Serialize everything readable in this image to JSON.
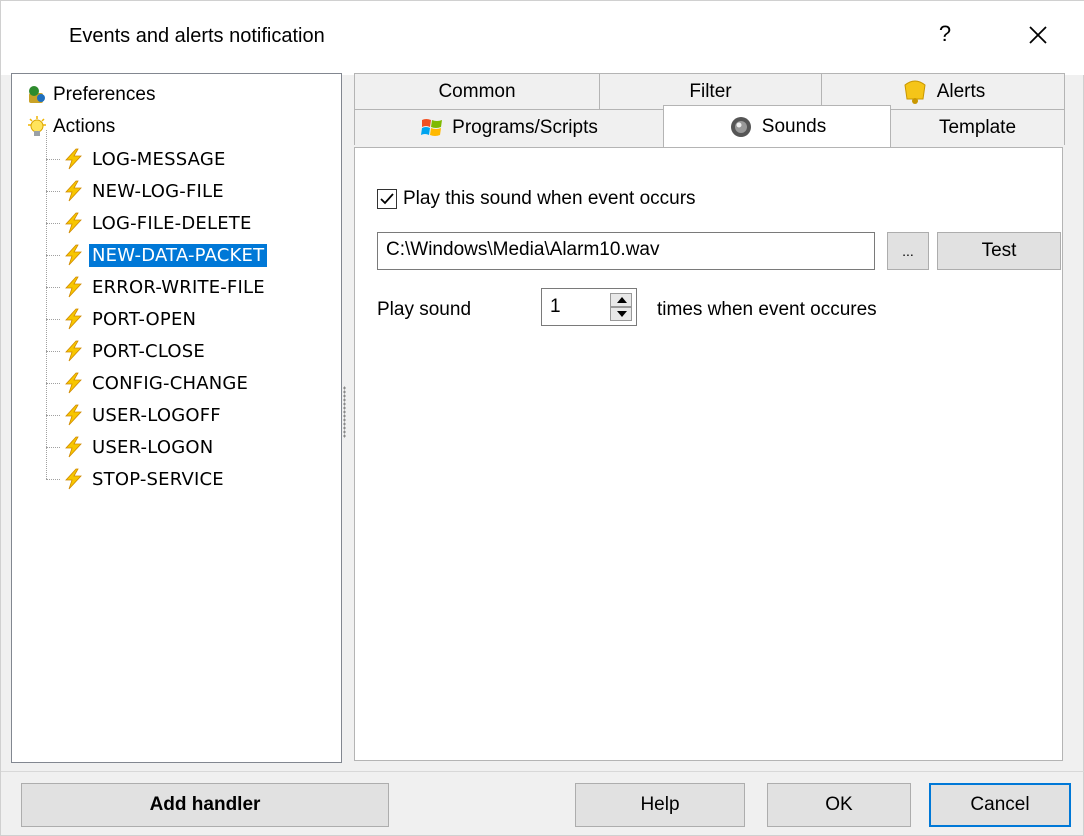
{
  "window": {
    "title": "Events and alerts notification",
    "help_glyph": "?",
    "close_glyph": "✕"
  },
  "tree": {
    "root_items": [
      {
        "label": "Preferences",
        "icon": "preferences-icon"
      },
      {
        "label": "Actions",
        "icon": "lightbulb-icon"
      }
    ],
    "action_items": [
      {
        "label": "LOG-MESSAGE",
        "selected": false
      },
      {
        "label": "NEW-LOG-FILE",
        "selected": false
      },
      {
        "label": "LOG-FILE-DELETE",
        "selected": false
      },
      {
        "label": "NEW-DATA-PACKET",
        "selected": true
      },
      {
        "label": "ERROR-WRITE-FILE",
        "selected": false
      },
      {
        "label": "PORT-OPEN",
        "selected": false
      },
      {
        "label": "PORT-CLOSE",
        "selected": false
      },
      {
        "label": "CONFIG-CHANGE",
        "selected": false
      },
      {
        "label": "USER-LOGOFF",
        "selected": false
      },
      {
        "label": "USER-LOGON",
        "selected": false
      },
      {
        "label": "STOP-SERVICE",
        "selected": false
      }
    ],
    "item_icon": "lightning-icon",
    "selected_color": "#0078d7"
  },
  "tabs": {
    "row1": [
      {
        "label": "Common"
      },
      {
        "label": "Filter"
      },
      {
        "label": "Alerts",
        "icon": "bell-icon"
      }
    ],
    "row2": [
      {
        "label": "Programs/Scripts",
        "icon": "windows-flag-icon"
      },
      {
        "label": "Sounds",
        "icon": "speaker-icon",
        "active": true
      },
      {
        "label": "Template"
      }
    ]
  },
  "sounds": {
    "play_checkbox_label": "Play this sound when event occurs",
    "play_checked": true,
    "file_path": "C:\\Windows\\Media\\Alarm10.wav",
    "browse_label": "...",
    "test_label": "Test",
    "play_sound_label": "Play sound",
    "times_value": "1",
    "times_suffix": "times when event occures"
  },
  "footer": {
    "add_handler": "Add handler",
    "help": "Help",
    "ok": "OK",
    "cancel": "Cancel"
  }
}
